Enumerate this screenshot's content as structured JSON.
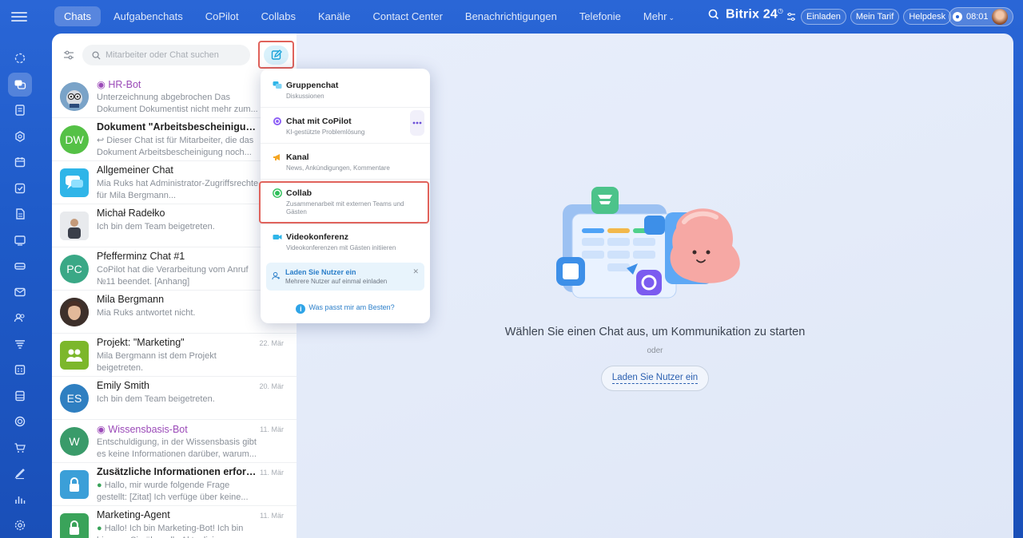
{
  "rail": {
    "icons": [
      "menu-icon",
      "activity-icon",
      "chats-icon",
      "feed-icon",
      "copilot-icon",
      "calendar-icon",
      "tasks-icon",
      "documents-icon",
      "crm-icon",
      "drive-icon",
      "mail-icon",
      "users-icon",
      "sites-icon",
      "planner-icon",
      "inventory-icon",
      "analytics-icon",
      "shop-icon",
      "signature-icon",
      "reports-icon",
      "settings-icon"
    ]
  },
  "topbar": {
    "tabs": [
      {
        "label": "Chats"
      },
      {
        "label": "Aufgabenchats"
      },
      {
        "label": "CoPilot"
      },
      {
        "label": "Collabs"
      },
      {
        "label": "Kanäle"
      },
      {
        "label": "Contact Center"
      },
      {
        "label": "Benachrichtigungen"
      },
      {
        "label": "Telefonie"
      },
      {
        "label": "Mehr"
      }
    ],
    "brand": "Bitrix 24",
    "invite_label": "Einladen",
    "plan_label": "Mein Tarif",
    "helpdesk_label": "Helpdesk",
    "time": "08:01"
  },
  "list": {
    "search_placeholder": "Mitarbeiter oder Chat suchen",
    "chats": [
      {
        "title": "HR-Bot",
        "msg": "Unterzeichnung abgebrochen Das Dokument Dokumentist nicht mehr zum...",
        "date": "",
        "avatar_text": "",
        "avatar_color": "#6a8fb0"
      },
      {
        "title": "Dokument \"Arbeitsbescheinigung\" ...",
        "msg": "Dieser Chat ist für Mitarbeiter, die das Dokument Arbeitsbescheinigung noch...",
        "date": "",
        "avatar_text": "DW",
        "avatar_color": "#55c146"
      },
      {
        "title": "Allgemeiner Chat",
        "msg": "Mia Ruks hat Administrator-Zugriffsrechte für Mila Bergmann...",
        "date": "",
        "avatar_text": "",
        "avatar_color": "#2fb5e8"
      },
      {
        "title": "Michał Radełko",
        "msg": "Ich bin dem Team beigetreten.",
        "date": "",
        "avatar_text": "",
        "avatar_color": "#c9ccd1"
      },
      {
        "title": "Pfefferminz Chat #1",
        "msg": "CoPilot hat die Verarbeitung vom Anruf №11 beendet. [Anhang]",
        "date": "",
        "avatar_text": "PC",
        "avatar_color": "#3aa886"
      },
      {
        "title": "Mila Bergmann",
        "msg": "Mia Ruks antwortet nicht.",
        "date": "",
        "avatar_text": "",
        "avatar_color": "#5b4a44"
      },
      {
        "title": "Projekt: \"Marketing\"",
        "msg": "Mila Bergmann ist dem Projekt beigetreten.",
        "date": "22. Mär",
        "avatar_text": "",
        "avatar_color": "#7cb72b"
      },
      {
        "title": "Emily Smith",
        "msg": "Ich bin dem Team beigetreten.",
        "date": "20. Mär",
        "avatar_text": "ES",
        "avatar_color": "#2f7fc1"
      },
      {
        "title": "Wissensbasis-Bot",
        "msg": "Entschuldigung, in der Wissensbasis gibt es keine Informationen darüber, warum...",
        "date": "11. Mär",
        "avatar_text": "W",
        "avatar_color": "#3a9b6a"
      },
      {
        "title": "Zusätzliche Informationen erforder...",
        "msg": "Hallo, mir wurde folgende Frage gestellt: [Zitat] Ich verfüge über keine...",
        "date": "11. Mär",
        "avatar_text": "",
        "avatar_color": "#3b9fd8"
      },
      {
        "title": "Marketing-Agent",
        "msg": "Hallo! Ich bin Marketing-Bot! Ich bin hier, um Sie über alle Aktualisierungen...",
        "date": "11. Mär",
        "avatar_text": "",
        "avatar_color": "#3aa35a"
      }
    ]
  },
  "menu": {
    "items": [
      {
        "label": "Gruppenchat",
        "sub": "Diskussionen"
      },
      {
        "label": "Chat mit CoPilot",
        "sub": "KI-gestützte Problemlösung"
      },
      {
        "label": "Kanal",
        "sub": "News, Ankündigungen, Kommentare"
      },
      {
        "label": "Collab",
        "sub": "Zusammenarbeit mit externen Teams und Gästen"
      },
      {
        "label": "Videokonferenz",
        "sub": "Videokonferenzen mit Gästen initiieren"
      }
    ],
    "invite_title": "Laden Sie Nutzer ein",
    "invite_sub": "Mehrere Nutzer auf einmal einladen",
    "help": "Was passt mir am Besten?"
  },
  "main": {
    "empty_title": "Wählen Sie einen Chat aus, um Kommunikation zu starten",
    "or": "oder",
    "invite_button": "Laden Sie Nutzer ein"
  }
}
